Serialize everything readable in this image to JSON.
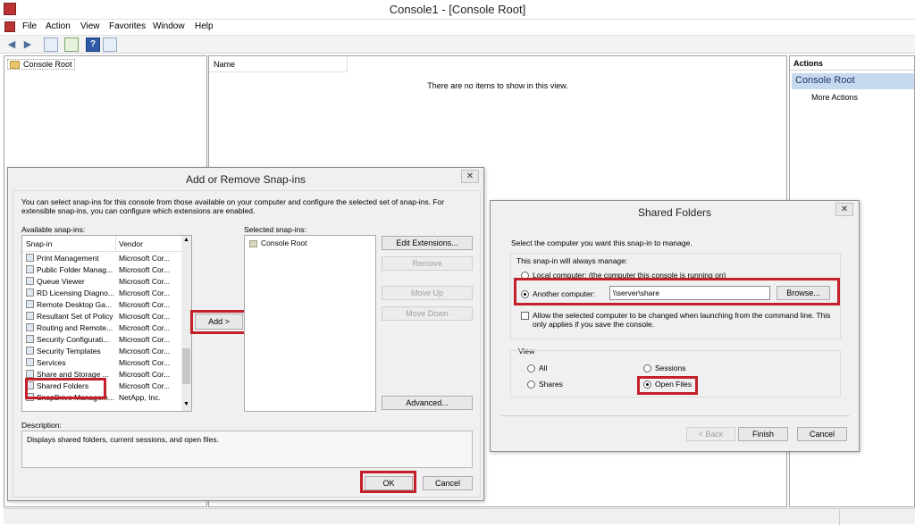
{
  "window": {
    "title": "Console1 - [Console Root]"
  },
  "menu": [
    "File",
    "Action",
    "View",
    "Favorites",
    "Window",
    "Help"
  ],
  "tree": {
    "root_label": "Console Root"
  },
  "list": {
    "column_name": "Name",
    "empty_message": "There are no items to show in this view."
  },
  "actions": {
    "header": "Actions",
    "section": "Console Root",
    "more": "More Actions"
  },
  "snapins_dialog": {
    "title": "Add or Remove Snap-ins",
    "intro": "You can select snap-ins for this console from those available on your computer and configure the selected set of snap-ins. For extensible snap-ins, you can configure which extensions are enabled.",
    "available_label": "Available snap-ins:",
    "col_snapin": "Snap-in",
    "col_vendor": "Vendor",
    "rows": [
      {
        "name": "Print Management",
        "vendor": "Microsoft Cor..."
      },
      {
        "name": "Public Folder Manag...",
        "vendor": "Microsoft Cor..."
      },
      {
        "name": "Queue Viewer",
        "vendor": "Microsoft Cor..."
      },
      {
        "name": "RD Licensing Diagno...",
        "vendor": "Microsoft Cor..."
      },
      {
        "name": "Remote Desktop Ga...",
        "vendor": "Microsoft Cor..."
      },
      {
        "name": "Resultant Set of Policy",
        "vendor": "Microsoft Cor..."
      },
      {
        "name": "Routing and Remote...",
        "vendor": "Microsoft Cor..."
      },
      {
        "name": "Security Configurati...",
        "vendor": "Microsoft Cor..."
      },
      {
        "name": "Security Templates",
        "vendor": "Microsoft Cor..."
      },
      {
        "name": "Services",
        "vendor": "Microsoft Cor..."
      },
      {
        "name": "Share and Storage ...",
        "vendor": "Microsoft Cor..."
      },
      {
        "name": "Shared Folders",
        "vendor": "Microsoft Cor..."
      },
      {
        "name": "SnapDrive Managem...",
        "vendor": "NetApp, Inc."
      }
    ],
    "add_button": "Add >",
    "selected_label": "Selected snap-ins:",
    "selected_item": "Console Root",
    "edit_extensions": "Edit Extensions...",
    "remove": "Remove",
    "move_up": "Move Up",
    "move_down": "Move Down",
    "advanced": "Advanced...",
    "description_label": "Description:",
    "description": "Displays shared folders, current sessions, and open files.",
    "ok": "OK",
    "cancel": "Cancel"
  },
  "shared_dialog": {
    "title": "Shared Folders",
    "prompt": "Select the computer you want this snap-in to manage.",
    "group_manage": "This snap-in will always manage:",
    "local_computer": "Local computer:  (the computer this console is running on)",
    "another_computer": "Another computer:",
    "computer_value": "\\\\server\\share",
    "browse": "Browse...",
    "allow_change": "Allow the selected computer to be changed when launching from the command line.  This only applies if you save the console.",
    "group_view": "View",
    "view_all": "All",
    "view_sessions": "Sessions",
    "view_shares": "Shares",
    "view_open_files": "Open Files",
    "back": "< Back",
    "finish": "Finish",
    "cancel": "Cancel"
  },
  "icons": [
    "console-icon",
    "back-arrow-icon",
    "forward-arrow-icon",
    "show-hide-tree-icon",
    "export-list-icon",
    "help-icon",
    "show-hide-action-pane-icon",
    "folder-icon",
    "close-icon"
  ]
}
